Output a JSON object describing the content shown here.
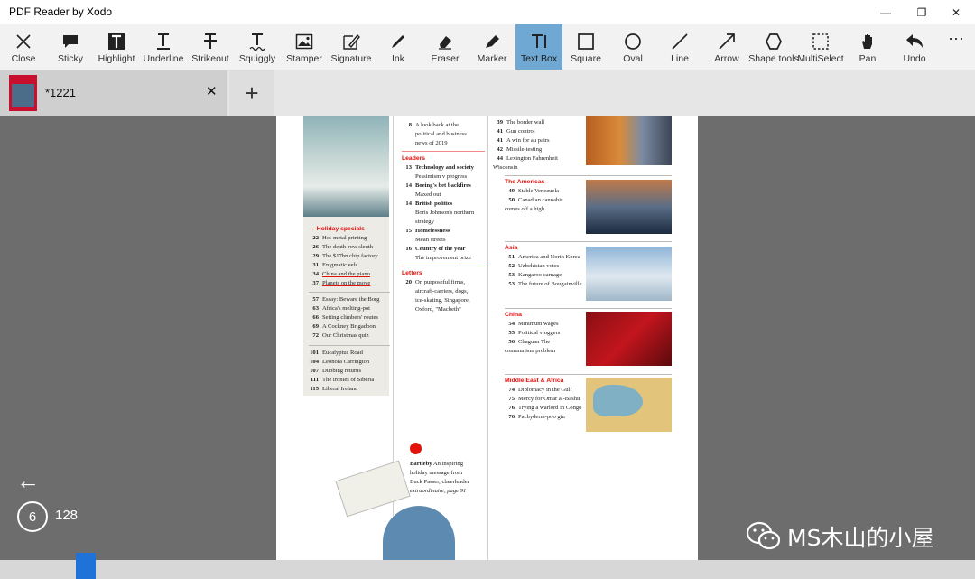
{
  "app": {
    "title": "PDF Reader by Xodo"
  },
  "window_controls": {
    "minimize": "—",
    "restore": "❐",
    "close": "✕"
  },
  "toolbar": {
    "tools": [
      {
        "label": "Close",
        "icon": "close-icon",
        "glyph": "✕"
      },
      {
        "label": "Sticky",
        "icon": "sticky-note-icon",
        "glyph": "▆"
      },
      {
        "label": "Highlight",
        "icon": "highlight-icon",
        "glyph": "T"
      },
      {
        "label": "Underline",
        "icon": "underline-icon",
        "glyph": "T"
      },
      {
        "label": "Strikeout",
        "icon": "strikeout-icon",
        "glyph": "T"
      },
      {
        "label": "Squiggly",
        "icon": "squiggly-icon",
        "glyph": "T"
      },
      {
        "label": "Stamper",
        "icon": "image-stamp-icon",
        "glyph": "▣"
      },
      {
        "label": "Signature",
        "icon": "signature-icon",
        "glyph": "✎"
      },
      {
        "label": "Ink",
        "icon": "ink-pen-icon",
        "glyph": "✒"
      },
      {
        "label": "Eraser",
        "icon": "eraser-icon",
        "glyph": "◆"
      },
      {
        "label": "Marker",
        "icon": "marker-icon",
        "glyph": "✎"
      },
      {
        "label": "Text Box",
        "icon": "text-box-icon",
        "glyph": "T",
        "active": true
      },
      {
        "label": "Square",
        "icon": "square-icon",
        "glyph": "□"
      },
      {
        "label": "Oval",
        "icon": "oval-icon",
        "glyph": "○"
      },
      {
        "label": "Line",
        "icon": "line-icon",
        "glyph": "╱"
      },
      {
        "label": "Arrow",
        "icon": "arrow-icon",
        "glyph": "↗"
      },
      {
        "label": "Shape tools",
        "icon": "hexagon-icon",
        "glyph": "⬡"
      },
      {
        "label": "MultiSelect",
        "icon": "multiselect-icon",
        "glyph": "⬚"
      },
      {
        "label": "Pan",
        "icon": "hand-icon",
        "glyph": "✋"
      },
      {
        "label": "Undo",
        "icon": "undo-icon",
        "glyph": "↶"
      }
    ],
    "more": "···"
  },
  "tabs": {
    "doc_name": "*1221",
    "close": "✕",
    "add": "+"
  },
  "page_content": {
    "left_col": {
      "section_title": "→ Holiday specials",
      "holiday": [
        {
          "n": "22",
          "t": "Hot-metal printing"
        },
        {
          "n": "26",
          "t": "The death-row sleuth"
        },
        {
          "n": "29",
          "t": "The $17bn chip factory"
        },
        {
          "n": "31",
          "t": "Enigmatic eels"
        },
        {
          "n": "34",
          "t": "China and the piano"
        },
        {
          "n": "37",
          "t": "Planets on the move"
        }
      ],
      "features": [
        {
          "n": "57",
          "t": "Essay: Beware the Borg"
        },
        {
          "n": "63",
          "t": "Africa's melting-pot"
        },
        {
          "n": "66",
          "t": "Setting climbers' routes"
        },
        {
          "n": "69",
          "t": "A Cockney Brigadoon"
        },
        {
          "n": "72",
          "t": "Our Christmas quiz"
        }
      ],
      "culture": [
        {
          "n": "101",
          "t": "Eucalyptus Road"
        },
        {
          "n": "104",
          "t": "Leonora Carrington"
        },
        {
          "n": "107",
          "t": "Dubbing returns"
        },
        {
          "n": "111",
          "t": "The ironies of Siberia"
        },
        {
          "n": "115",
          "t": "Liberal Ireland"
        }
      ]
    },
    "mid_col": {
      "top_item": {
        "n": "8",
        "lines": [
          "A look back at the",
          "political and business",
          "news of 2019"
        ]
      },
      "leaders_title": "Leaders",
      "leaders": [
        {
          "n": "13",
          "b": "Technology and society",
          "t": "Pessimism v progress"
        },
        {
          "n": "14",
          "b": "Boeing's bet backfires",
          "t": "Maxed out"
        },
        {
          "n": "14",
          "b": "British politics",
          "t": "Boris Johnson's northern strategy"
        },
        {
          "n": "15",
          "b": "Homelessness",
          "t": "Mean streets"
        },
        {
          "n": "16",
          "b": "Country of the year",
          "t": "The improvement prize"
        }
      ],
      "letters_title": "Letters",
      "letters": {
        "n": "20",
        "lines": [
          "On purposeful firms,",
          "aircraft-carriers, dogs,",
          "ice-skating, Singapore,",
          "Oxford, \"Macbeth\""
        ]
      },
      "bartleby": {
        "b": "Bartleby",
        "lines": [
          "An inspiring",
          "holiday message from",
          "Buck Passer, cheerleader",
          "extraordinaire, page 91"
        ]
      }
    },
    "right_col": {
      "us": [
        {
          "n": "39",
          "t": "The border wall"
        },
        {
          "n": "41",
          "t": "Gun control"
        },
        {
          "n": "41",
          "t": "A win for au pairs"
        },
        {
          "n": "42",
          "t": "Missile-testing"
        },
        {
          "n": "44",
          "t": "Lexington Fahrenheit Wisconsin"
        }
      ],
      "americas_title": "The Americas",
      "americas": [
        {
          "n": "49",
          "t": "Stable Venezuela"
        },
        {
          "n": "50",
          "t": "Canadian cannabis comes off a high"
        }
      ],
      "asia_title": "Asia",
      "asia": [
        {
          "n": "51",
          "t": "America and North Korea"
        },
        {
          "n": "52",
          "t": "Uzbekistan votes"
        },
        {
          "n": "53",
          "t": "Kangaroo carnage"
        },
        {
          "n": "53",
          "t": "The future of Bougainville"
        }
      ],
      "china_title": "China",
      "china": [
        {
          "n": "54",
          "t": "Minimum wages"
        },
        {
          "n": "55",
          "t": "Political vloggers"
        },
        {
          "n": "56",
          "t": "Chaguan The communism problem"
        }
      ],
      "mea_title": "Middle East & Africa",
      "mea": [
        {
          "n": "74",
          "t": "Diplomacy in the Gulf"
        },
        {
          "n": "75",
          "t": "Mercy for Omar al-Bashir"
        },
        {
          "n": "76",
          "t": "Trying a warlord in Congo"
        },
        {
          "n": "76",
          "t": "Pachyderm-poo gin"
        }
      ]
    }
  },
  "navigation": {
    "back": "←",
    "current_page": "6",
    "total_pages": "128"
  },
  "watermark": {
    "text": "MS木山的小屋"
  }
}
